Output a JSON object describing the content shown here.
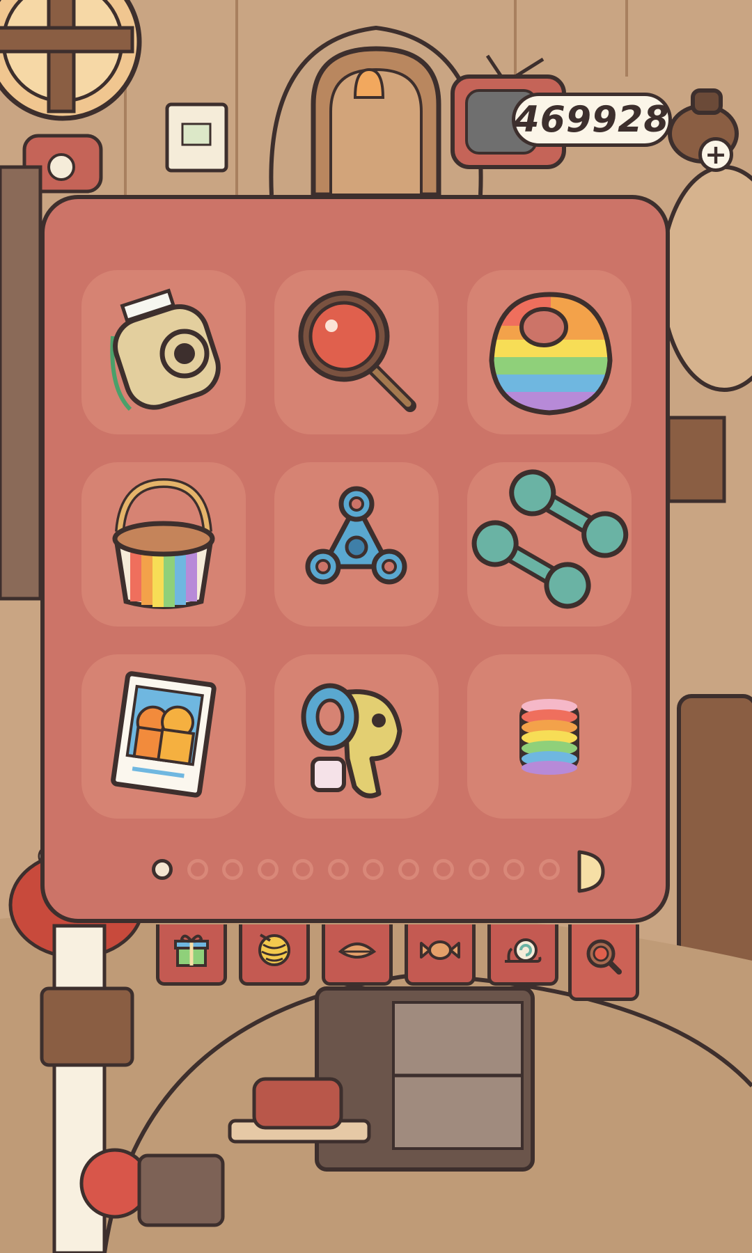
{
  "currency": {
    "value": "469928",
    "icon": "coin-bag-icon",
    "add_icon": "plus-icon"
  },
  "items": [
    {
      "id": "instant-camera",
      "icon": "instant-camera-icon"
    },
    {
      "id": "magnifying-glass",
      "icon": "magnifying-glass-icon"
    },
    {
      "id": "rainbow-bib",
      "icon": "rainbow-bib-icon"
    },
    {
      "id": "rainbow-bucket",
      "icon": "rainbow-bucket-icon"
    },
    {
      "id": "fidget-spinner",
      "icon": "fidget-spinner-icon"
    },
    {
      "id": "dumbbells",
      "icon": "dumbbells-icon"
    },
    {
      "id": "photo",
      "icon": "photo-icon"
    },
    {
      "id": "bubble-gun",
      "icon": "bubble-gun-icon"
    },
    {
      "id": "rainbow-slinky",
      "icon": "rainbow-slinky-icon"
    }
  ],
  "pagination": {
    "current_page": 1,
    "total_pages": 12
  },
  "tabs": [
    {
      "id": "gift",
      "icon": "gift-icon",
      "active": false
    },
    {
      "id": "yarn",
      "icon": "yarn-ball-icon",
      "active": false
    },
    {
      "id": "leaf",
      "icon": "leaf-icon",
      "active": false
    },
    {
      "id": "candy",
      "icon": "candy-icon",
      "active": false
    },
    {
      "id": "snail",
      "icon": "snail-icon",
      "active": false
    },
    {
      "id": "magnifier",
      "icon": "magnifier-icon",
      "active": true
    }
  ],
  "colors": {
    "panel": "#cc7468",
    "slot": "#d68373",
    "tab": "#c45a52",
    "outline": "#3d2f2d",
    "coin_counter_bg": "#fbf5e8"
  }
}
